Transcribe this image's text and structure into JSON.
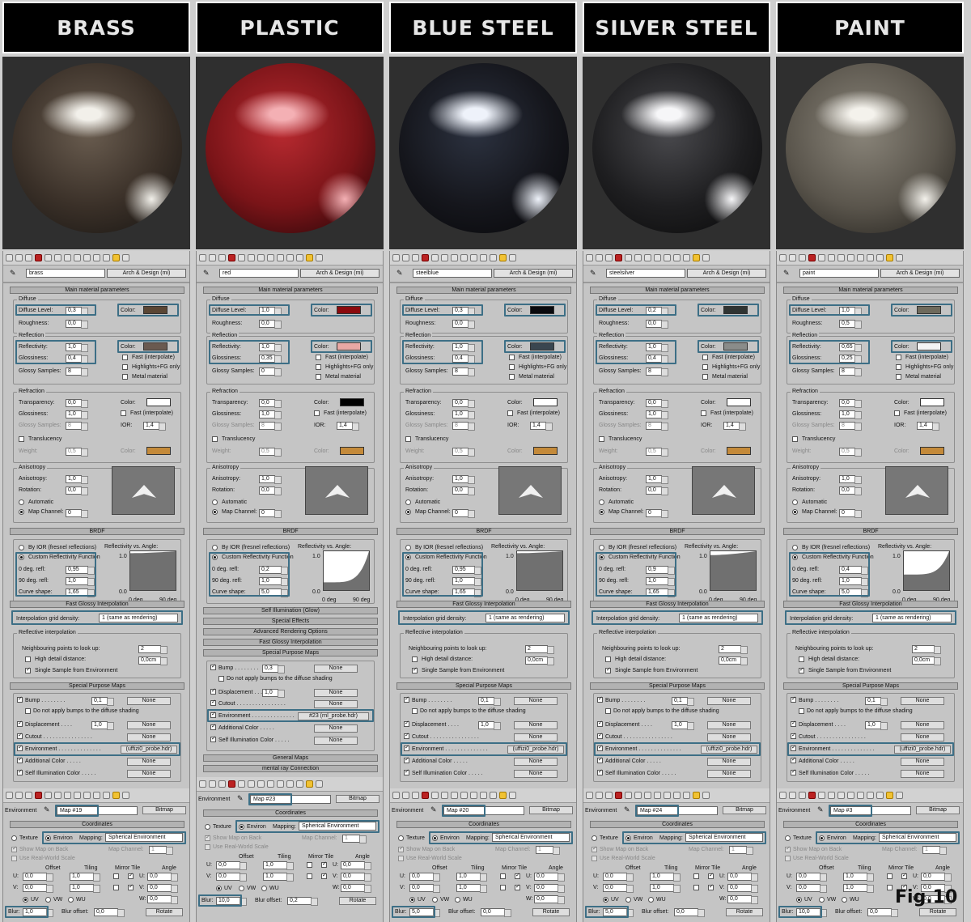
{
  "figure_label": "Fig.10",
  "labels": {
    "main_material_parameters": "Main material parameters",
    "diffuse": "Diffuse",
    "diffuse_level": "Diffuse Level:",
    "roughness": "Roughness:",
    "color": "Color:",
    "reflection": "Reflection",
    "reflectivity": "Reflectivity:",
    "glossiness": "Glossiness:",
    "glossy_samples": "Glossy Samples:",
    "fast_interpolate": "Fast (interpolate)",
    "highlights_fg_only": "Highlights+FG only",
    "metal_material": "Metal material",
    "refraction": "Refraction",
    "transparency": "Transparency:",
    "ior": "IOR:",
    "translucency": "Translucency",
    "weight": "Weight:",
    "anisotropy_group": "Anisotropy",
    "anisotropy": "Anisotropy:",
    "rotation": "Rotation:",
    "automatic": "Automatic",
    "map_channel": "Map Channel:",
    "brdf": "BRDF",
    "by_ior": "By IOR (fresnel reflections)",
    "custom_reflectivity": "Custom Reflectivity Function",
    "deg0": "0 deg. refl:",
    "deg90": "90 deg. refl:",
    "curve_shape": "Curve shape:",
    "reflectivity_vs_angle": "Reflectivity vs. Angle:",
    "graph_y1": "1.0",
    "graph_y0": "0.0",
    "graph_x0": "0 deg",
    "graph_x90": "90 deg",
    "fast_glossy_interpolation": "Fast Glossy Interpolation",
    "interpolation_grid_density": "Interpolation grid density:",
    "reflective_interpolation": "Reflective interpolation",
    "neighbouring_points": "Neighbouring points to look up:",
    "high_detail_distance": "High detail distance:",
    "single_sample": "Single Sample from Environment",
    "special_purpose_maps": "Special Purpose Maps",
    "bump": "Bump . . . . . . . .",
    "do_not_apply_bumps": "Do not apply bumps to the diffuse shading",
    "displacement": "Displacement . . . .",
    "cutout": "Cutout . . . . . . . . . . . . . . . .",
    "environment_map": "Environment . . . . . . . . . . . . . .",
    "additional_color": "Additional Color . . . . .",
    "self_illumination_color": "Self Illumination Color . . . . .",
    "none": "None",
    "self_illumination_glow": "Self Illumination (Glow)",
    "special_effects": "Special Effects",
    "advanced_rendering_options": "Advanced Rendering Options",
    "general_maps": "General Maps",
    "mental_ray_connection": "mental ray Connection",
    "environment": "Environment",
    "bitmap": "Bitmap",
    "coordinates": "Coordinates",
    "texture": "Texture",
    "environ": "Environ",
    "mapping": "Mapping:",
    "show_map_on_back": "Show Map on Back",
    "use_real_world_scale": "Use Real-World Scale",
    "offset": "Offset",
    "tiling": "Tiling",
    "mirror_tile": "Mirror Tile",
    "angle": "Angle",
    "u": "U:",
    "v": "V:",
    "w": "W:",
    "uv": "UV",
    "vw": "VW",
    "wu": "WU",
    "blur": "Blur:",
    "blur_offset": "Blur offset:",
    "rotate": "Rotate",
    "map_channel_1": "1"
  },
  "materials": [
    {
      "title": "BRASS",
      "name": "brass",
      "type": "Arch & Design (mi)",
      "sphere": {
        "base": "#3a3028",
        "mid": "#6a5d50",
        "highlight": "#f2f0ea",
        "dark": "#141210"
      },
      "diffuse_level": "0,3",
      "roughness": "0,0",
      "diffuse_color": "#5a4634",
      "reflectivity": "1,0",
      "glossiness": "0,4",
      "glossy_samples": "8",
      "reflection_color": "#6a5a50",
      "transparency": "0,0",
      "refr_glossiness": "1,0",
      "refr_samples": "8",
      "ior": "1,4",
      "refraction_color": "#ffffff",
      "weight": "0,5",
      "transl_color": "#c48a3a",
      "anisotropy": "1,0",
      "rotation": "0,0",
      "map_channel": "0",
      "deg0": "0,95",
      "deg90": "1,0",
      "curve": "1,65",
      "interpolation": "1 (same as rendering)",
      "neighbour": "2",
      "detail_distance": "0,0cm",
      "bump": "0,1",
      "displacement": "1,0",
      "env_map": "(uffizi0_probe.hdr)",
      "map_name": "Map #19",
      "mapping": "Spherical Environment",
      "u_offset": "0,0",
      "v_offset": "0,0",
      "u_tiling": "1,0",
      "v_tiling": "1,0",
      "u_angle": "0,0",
      "v_angle": "0,0",
      "w_angle": "0,0",
      "blur": "1,0",
      "blur_offset": "0,0"
    },
    {
      "title": "PLASTIC",
      "name": "red",
      "type": "Arch & Design (mi)",
      "sphere": {
        "base": "#7a1418",
        "mid": "#b82a30",
        "highlight": "#f4b0b4",
        "dark": "#1a0406"
      },
      "diffuse_level": "1,0",
      "roughness": "0,0",
      "diffuse_color": "#8a0a0e",
      "reflectivity": "1,0",
      "glossiness": "0,35",
      "glossy_samples": "0",
      "reflection_color": "#e8a8a4",
      "transparency": "0,0",
      "refr_glossiness": "1,0",
      "refr_samples": "8",
      "ior": "1,4",
      "refraction_color": "#000000",
      "weight": "0,5",
      "transl_color": "#c48a3a",
      "anisotropy": "1,0",
      "rotation": "0,0",
      "map_channel": "0",
      "deg0": "0,2",
      "deg90": "1,0",
      "curve": "5,0",
      "interpolation": "",
      "neighbour": "",
      "detail_distance": "",
      "bump": "0,3",
      "displacement": "1,0",
      "env_map": "#23 (rnl_probe.hdr)",
      "map_name": "Map #23",
      "mapping": "Spherical Environment",
      "u_offset": "0,0",
      "v_offset": "0,0",
      "u_tiling": "1,0",
      "v_tiling": "1,0",
      "u_angle": "0,0",
      "v_angle": "0,0",
      "w_angle": "0,0",
      "blur": "10,0",
      "blur_offset": "0,2"
    },
    {
      "title": "BLUE STEEL",
      "name": "steelblue",
      "type": "Arch & Design (mi)",
      "sphere": {
        "base": "#15161c",
        "mid": "#2c3240",
        "highlight": "#eef2fa",
        "dark": "#060608"
      },
      "diffuse_level": "0,3",
      "roughness": "0,0",
      "diffuse_color": "#0a0a0e",
      "reflectivity": "1,0",
      "glossiness": "0,4",
      "glossy_samples": "8",
      "reflection_color": "#3a4650",
      "transparency": "0,0",
      "refr_glossiness": "1,0",
      "refr_samples": "8",
      "ior": "1,4",
      "refraction_color": "#ffffff",
      "weight": "0,5",
      "transl_color": "#c48a3a",
      "anisotropy": "1,0",
      "rotation": "0,0",
      "map_channel": "0",
      "deg0": "0,95",
      "deg90": "1,0",
      "curve": "1,65",
      "interpolation": "1 (same as rendering)",
      "neighbour": "2",
      "detail_distance": "0,0cm",
      "bump": "0,1",
      "displacement": "1,0",
      "env_map": "(uffizi0_probe.hdr)",
      "map_name": "Map #20",
      "mapping": "Spherical Environment",
      "u_offset": "0,0",
      "v_offset": "0,0",
      "u_tiling": "1,0",
      "v_tiling": "1,0",
      "u_angle": "0,0",
      "v_angle": "0,0",
      "w_angle": "0,0",
      "blur": "5,0",
      "blur_offset": "0,0"
    },
    {
      "title": "SILVER STEEL",
      "name": "steelsilver",
      "type": "Arch & Design (mi)",
      "sphere": {
        "base": "#1e1e20",
        "mid": "#4a4a4e",
        "highlight": "#f6f6f8",
        "dark": "#080808"
      },
      "diffuse_level": "0,2",
      "roughness": "0,0",
      "diffuse_color": "#303432",
      "reflectivity": "1,0",
      "glossiness": "0,4",
      "glossy_samples": "8",
      "reflection_color": "#8a8c8a",
      "transparency": "0,0",
      "refr_glossiness": "1,0",
      "refr_samples": "8",
      "ior": "1,4",
      "refraction_color": "#ffffff",
      "weight": "0,5",
      "transl_color": "#c48a3a",
      "anisotropy": "1,0",
      "rotation": "0,0",
      "map_channel": "0",
      "deg0": "0,9",
      "deg90": "1,0",
      "curve": "1,65",
      "interpolation": "1 (same as rendering)",
      "neighbour": "2",
      "detail_distance": "0,0cm",
      "bump": "0,1",
      "displacement": "1,0",
      "env_map": "(uffizi0_probe.hdr)",
      "map_name": "Map #24",
      "mapping": "Spherical Environment",
      "u_offset": "0,0",
      "v_offset": "0,0",
      "u_tiling": "1,0",
      "v_tiling": "1,0",
      "u_angle": "0,0",
      "v_angle": "0,0",
      "w_angle": "0,0",
      "blur": "5,0",
      "blur_offset": "0,0"
    },
    {
      "title": "PAINT",
      "name": "paint",
      "type": "Arch & Design (mi)",
      "sphere": {
        "base": "#5a554c",
        "mid": "#8a857a",
        "highlight": "#f4f2ec",
        "dark": "#1e1c18"
      },
      "diffuse_level": "1,0",
      "roughness": "0,5",
      "diffuse_color": "#6e6a5c",
      "reflectivity": "0,65",
      "glossiness": "0,25",
      "glossy_samples": "8",
      "reflection_color": "#f4f4f4",
      "transparency": "0,0",
      "refr_glossiness": "1,0",
      "refr_samples": "8",
      "ior": "1,4",
      "refraction_color": "#ffffff",
      "weight": "0,5",
      "transl_color": "#c48a3a",
      "anisotropy": "1,0",
      "rotation": "0,0",
      "map_channel": "0",
      "deg0": "0,4",
      "deg90": "1,0",
      "curve": "5,0",
      "interpolation": "1 (same as rendering)",
      "neighbour": "2",
      "detail_distance": "0,0cm",
      "bump": "0,1",
      "displacement": "1,0",
      "env_map": "(uffizi0_probe.hdr)",
      "map_name": "Map #3",
      "mapping": "Spherical Environment",
      "u_offset": "0,0",
      "v_offset": "0,0",
      "u_tiling": "1,0",
      "v_tiling": "1,0",
      "u_angle": "0,0",
      "v_angle": "0,0",
      "w_angle": "0,0",
      "blur": "10,0",
      "blur_offset": "0,0"
    }
  ]
}
